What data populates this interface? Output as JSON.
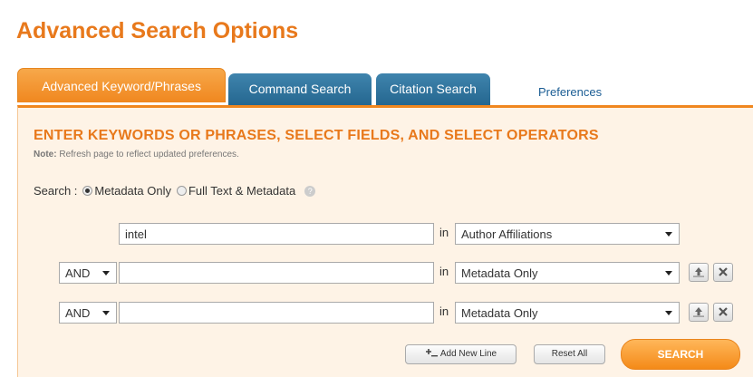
{
  "page": {
    "title": "Advanced Search Options"
  },
  "tabs": [
    {
      "label": "Advanced Keyword/Phrases",
      "active": true
    },
    {
      "label": "Command Search",
      "active": false
    },
    {
      "label": "Citation Search",
      "active": false
    }
  ],
  "preferences_link": "Preferences",
  "panel": {
    "heading": "ENTER KEYWORDS OR PHRASES, SELECT FIELDS, AND SELECT OPERATORS",
    "note_label": "Note:",
    "note_text": " Refresh page to reflect updated preferences."
  },
  "search_scope": {
    "label": "Search :",
    "options": [
      "Metadata Only",
      "Full Text & Metadata"
    ],
    "selected": "Metadata Only"
  },
  "rows": [
    {
      "operator": "",
      "value": "intel",
      "in_label": "in",
      "field": "Author Affiliations"
    },
    {
      "operator": "AND",
      "value": "",
      "in_label": "in",
      "field": "Metadata Only"
    },
    {
      "operator": "AND",
      "value": "",
      "in_label": "in",
      "field": "Metadata Only"
    }
  ],
  "buttons": {
    "add_new_line": "Add New Line",
    "reset_all": "Reset All",
    "search": "SEARCH"
  },
  "icons": {
    "move_up": "move-up-icon",
    "remove": "close-icon",
    "help": "help-icon",
    "add_line": "add-line-icon"
  },
  "colors": {
    "accent_orange": "#e8791c",
    "tab_blue": "#24668f",
    "panel_bg": "#fef3e6",
    "link_blue": "#1b5d94"
  }
}
